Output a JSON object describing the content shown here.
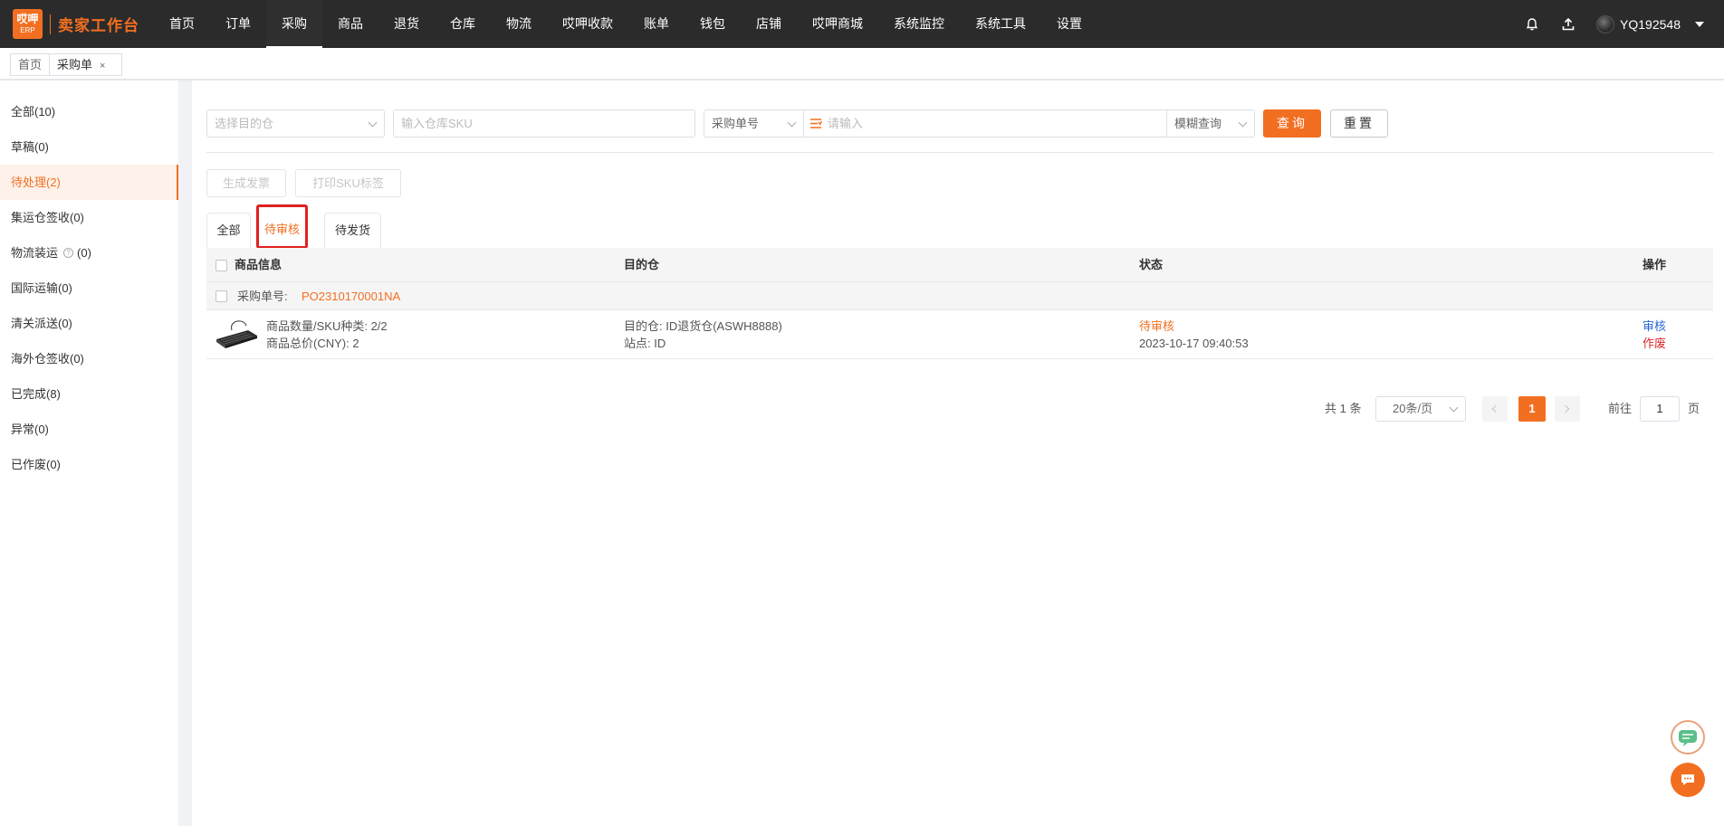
{
  "header": {
    "logo_top": "哎呷",
    "logo_bottom": "ERP",
    "app_title": "卖家工作台",
    "nav": [
      {
        "label": "首页"
      },
      {
        "label": "订单"
      },
      {
        "label": "采购"
      },
      {
        "label": "商品"
      },
      {
        "label": "退货"
      },
      {
        "label": "仓库"
      },
      {
        "label": "物流"
      },
      {
        "label": "哎呷收款"
      },
      {
        "label": "账单"
      },
      {
        "label": "钱包"
      },
      {
        "label": "店铺"
      },
      {
        "label": "哎呷商城"
      },
      {
        "label": "系统监控"
      },
      {
        "label": "系统工具"
      },
      {
        "label": "设置"
      }
    ],
    "active_nav": "采购",
    "username": "YQ192548",
    "icons": [
      "bell-icon",
      "upload-icon",
      "avatar"
    ]
  },
  "page_tabs": {
    "home": "首页",
    "current": "采购单",
    "close": "×"
  },
  "sidebar": {
    "items": [
      {
        "label": "全部(10)"
      },
      {
        "label": "草稿(0)"
      },
      {
        "label": "待处理(2)"
      },
      {
        "label": "集运仓签收(0)"
      },
      {
        "label": "物流装运",
        "suffix": "(0)"
      },
      {
        "label": "国际运输(0)"
      },
      {
        "label": "清关派送(0)"
      },
      {
        "label": "海外仓签收(0)"
      },
      {
        "label": "已完成(8)"
      },
      {
        "label": "异常(0)"
      },
      {
        "label": "已作废(0)"
      }
    ],
    "active_index": 2
  },
  "filters": {
    "warehouse_placeholder": "选择目的仓",
    "sku_placeholder": "输入仓库SKU",
    "search_type": "采购单号",
    "keyword_placeholder": "请输入",
    "match_mode": "模糊查询",
    "query_label": "查询",
    "reset_label": "重置"
  },
  "actions": {
    "generate_invoice": "生成发票",
    "print_sku": "打印SKU标签"
  },
  "tabs": [
    {
      "label": "全部"
    },
    {
      "label": "待审核"
    },
    {
      "label": "待发货"
    }
  ],
  "active_tab": "待审核",
  "table": {
    "columns": [
      "商品信息",
      "目的仓",
      "状态",
      "操作"
    ],
    "group": {
      "label": "采购单号:",
      "po_number": "PO2310170001NA"
    },
    "row": {
      "qty": "商品数量/SKU种类: 2/2",
      "total": "商品总价(CNY): 2",
      "warehouse": "目的仓: ID退货仓(ASWH8888)",
      "site": "站点: ID",
      "status": "待审核",
      "datetime": "2023-10-17 09:40:53",
      "action_review": "审核",
      "action_void": "作废"
    }
  },
  "pagination": {
    "total": "共 1 条",
    "page_size": "20条/页",
    "current_page": "1",
    "goto_label": "前往",
    "goto_value": "1",
    "page_unit": "页"
  },
  "colors": {
    "accent": "#f26f21",
    "topbar": "#2b2b2b",
    "link_blue": "#2a66d6",
    "danger": "#e0262a"
  }
}
